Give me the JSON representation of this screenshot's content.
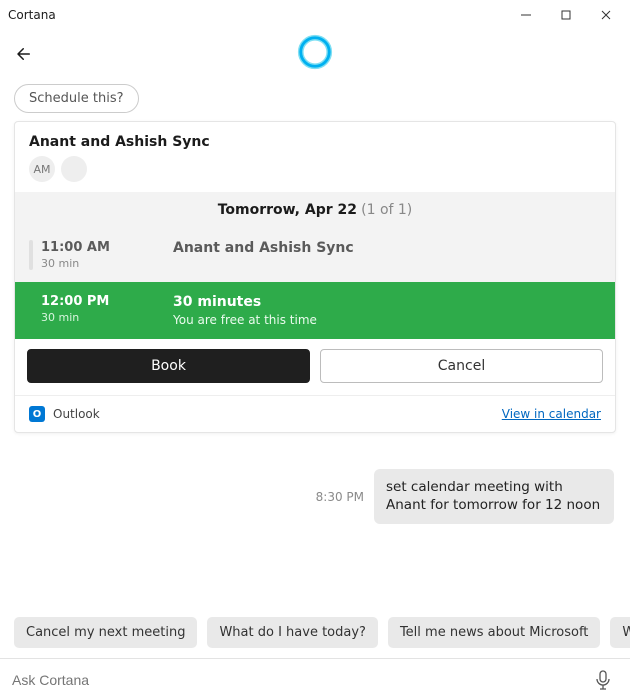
{
  "window": {
    "title": "Cortana"
  },
  "suggestion_top": "Schedule this?",
  "card": {
    "title": "Anant and Ashish Sync",
    "avatars": [
      {
        "label": "AM"
      },
      {
        "label": ""
      }
    ],
    "date_main": "Tomorrow, Apr 22",
    "date_count": "(1 of 1)",
    "slots": [
      {
        "time": "11:00 AM",
        "duration": "30 min",
        "title": "Anant and Ashish Sync",
        "subtitle": ""
      },
      {
        "time": "12:00 PM",
        "duration": "30 min",
        "title": "30 minutes",
        "subtitle": "You are free at this time"
      }
    ],
    "buttons": {
      "primary": "Book",
      "secondary": "Cancel"
    },
    "footer": {
      "app": "Outlook",
      "link": "View in calendar"
    }
  },
  "user_message": {
    "time": "8:30 PM",
    "text": "set calendar meeting with Anant for tomorrow for 12 noon"
  },
  "suggestions": [
    "Cancel my next meeting",
    "What do I have today?",
    "Tell me news about Microsoft",
    "What do I have next?"
  ],
  "input": {
    "placeholder": "Ask Cortana"
  }
}
